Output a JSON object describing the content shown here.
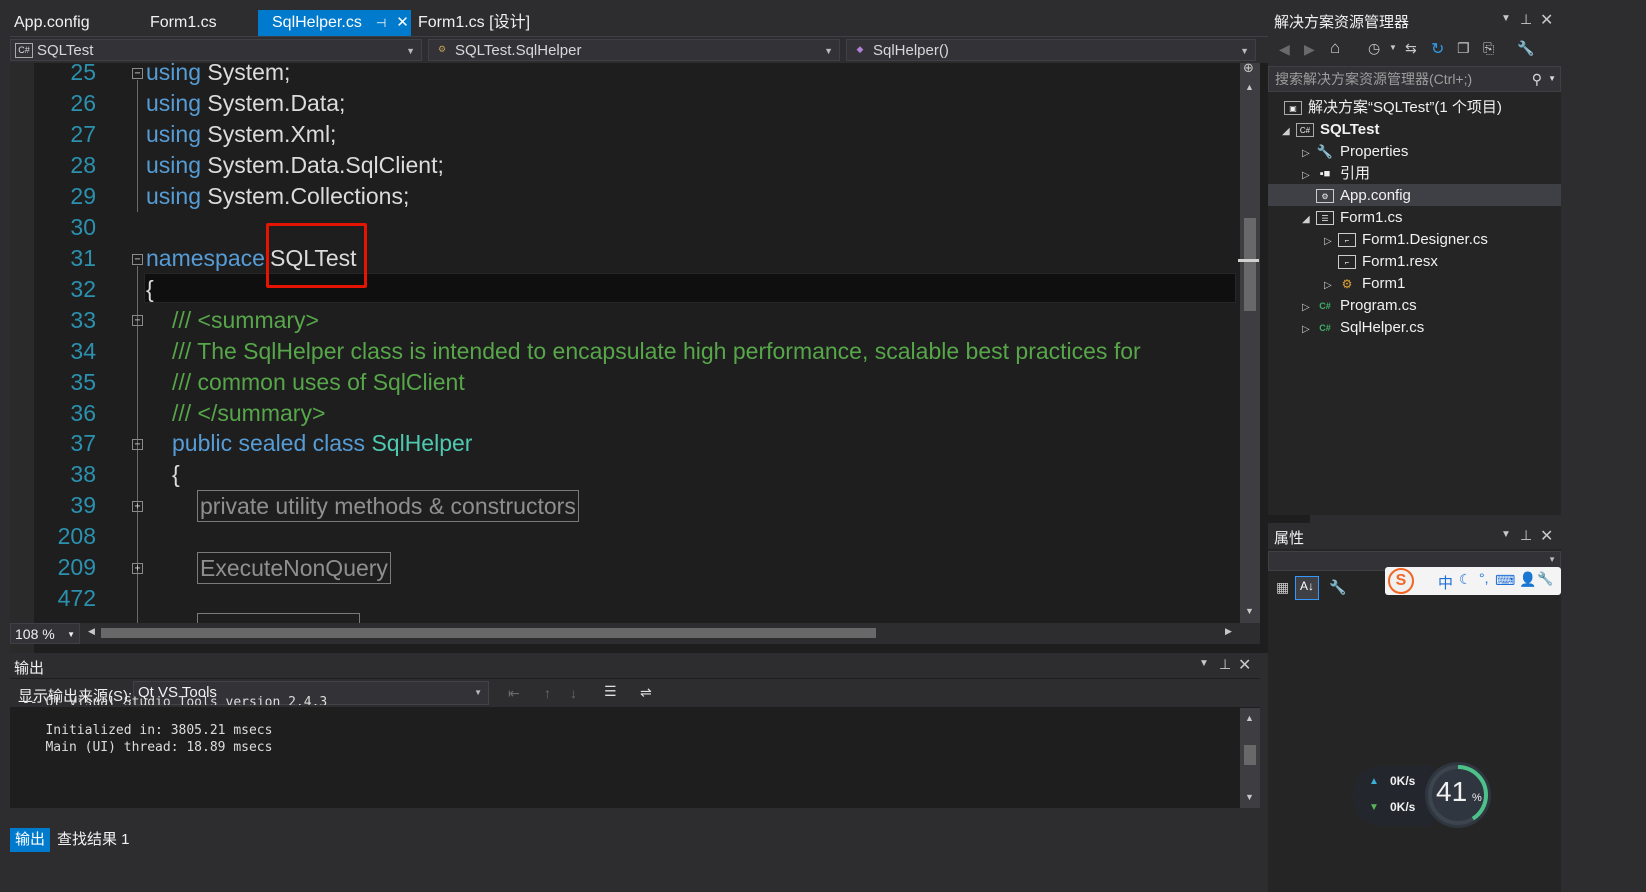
{
  "tabs": [
    {
      "label": "App.config"
    },
    {
      "label": "Form1.cs"
    },
    {
      "label": "SqlHelper.cs",
      "active": true
    },
    {
      "label": "Form1.cs [设计]"
    }
  ],
  "navbar": {
    "project": "SQLTest",
    "class": "SQLTest.SqlHelper",
    "member": "SqlHelper()"
  },
  "editor": {
    "lines": [
      {
        "num": "25",
        "kw": "using",
        "rest": " System;"
      },
      {
        "num": "26",
        "kw": "using",
        "rest": " System.Data;"
      },
      {
        "num": "27",
        "kw": "using",
        "rest": " System.Xml;"
      },
      {
        "num": "28",
        "kw": "using",
        "rest": " System.Data.SqlClient;"
      },
      {
        "num": "29",
        "kw": "using",
        "rest": " System.Collections;"
      },
      {
        "num": "30"
      },
      {
        "num": "31",
        "kw": "namespace",
        "rest": "SQLTest"
      },
      {
        "num": "32",
        "rest": "{"
      },
      {
        "num": "33",
        "comment": "/// <summary>"
      },
      {
        "num": "34",
        "comment": "/// The SqlHelper class is intended to encapsulate high performance, scalable best practices for"
      },
      {
        "num": "35",
        "comment": "/// common uses of SqlClient"
      },
      {
        "num": "36",
        "comment": "/// </summary>"
      },
      {
        "num": "37",
        "kw": "public sealed class",
        "type": "SqlHelper"
      },
      {
        "num": "38",
        "rest": "{"
      },
      {
        "num": "39",
        "region": "private utility methods & constructors"
      },
      {
        "num": "208"
      },
      {
        "num": "209",
        "region": "ExecuteNonQuery"
      },
      {
        "num": "472"
      }
    ],
    "zoom": "108 %"
  },
  "output": {
    "title": "输出",
    "source_label": "显示输出来源(S):",
    "source_value": "Qt VS Tools",
    "lines": [
      "-- Qt Visual Studio Tools version 2.4.3",
      "",
      "   Initialized in: 3805.21 msecs",
      "   Main (UI) thread: 18.89 msecs"
    ]
  },
  "bottom_tabs": [
    "输出",
    "查找结果 1"
  ],
  "solution_explorer": {
    "title": "解决方案资源管理器",
    "search_placeholder": "搜索解决方案资源管理器(Ctrl+;)",
    "items": [
      {
        "label": "解决方案“SQLTest”(1 个项目)",
        "icon": "solution-icon",
        "indent": 0,
        "arrow": ""
      },
      {
        "label": "SQLTest",
        "icon": "csharp-project-icon",
        "indent": 1,
        "arrow": "expanded",
        "bold": true
      },
      {
        "label": "Properties",
        "icon": "wrench-icon",
        "indent": 2,
        "arrow": "collapsed"
      },
      {
        "label": "引用",
        "icon": "references-icon",
        "indent": 2,
        "arrow": "collapsed"
      },
      {
        "label": "App.config",
        "icon": "config-file-icon",
        "indent": 2,
        "arrow": "",
        "selected": true
      },
      {
        "label": "Form1.cs",
        "icon": "form-icon",
        "indent": 2,
        "arrow": "expanded"
      },
      {
        "label": "Form1.Designer.cs",
        "icon": "cs-file-icon",
        "indent": 3,
        "arrow": "collapsed"
      },
      {
        "label": "Form1.resx",
        "icon": "resx-file-icon",
        "indent": 3,
        "arrow": ""
      },
      {
        "label": "Form1",
        "icon": "class-icon",
        "indent": 3,
        "arrow": "collapsed"
      },
      {
        "label": "Program.cs",
        "icon": "csharp-file-icon",
        "indent": 2,
        "arrow": "collapsed"
      },
      {
        "label": "SqlHelper.cs",
        "icon": "csharp-file-icon",
        "indent": 2,
        "arrow": "collapsed"
      }
    ]
  },
  "properties": {
    "title": "属性",
    "ime": "中"
  },
  "netmon": {
    "up": "0K/s",
    "down": "0K/s",
    "percent": "41",
    "percent_value": 41
  },
  "colors": {
    "accent": "#007acc",
    "highlight_box": "#e51400",
    "keyword": "#569cd6",
    "comment": "#57a64a",
    "type": "#4ec9b0",
    "line_number": "#2b91af"
  }
}
